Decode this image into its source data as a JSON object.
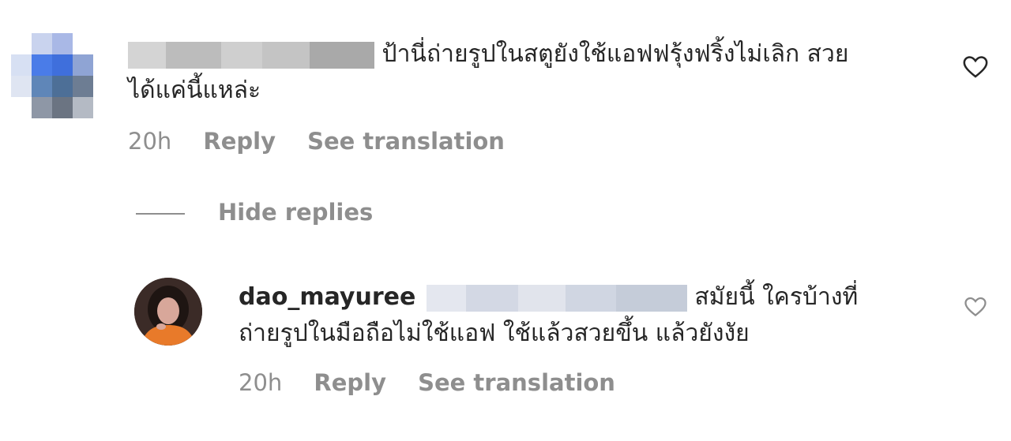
{
  "comments": [
    {
      "text_line1": "ป้านี่ถ่ายรูปในสตูยังใช้แอฟฟรุ้งฟริ้งไม่เลิก สวย",
      "text_line2": "ได้แค่นี้แหล่ะ",
      "time": "20h",
      "reply_label": "Reply",
      "translate_label": "See translation",
      "like_icon": "heart-outline-icon"
    }
  ],
  "hide_replies_label": "Hide replies",
  "replies": [
    {
      "username": "dao_mayuree",
      "text_line1": "สมัยนี้ ใครบ้างที่",
      "text_line2": "ถ่ายรูปในมือถือไม่ใช้แอฟ ใช้แล้วสวยขึ้น แล้วยังงัย",
      "time": "20h",
      "reply_label": "Reply",
      "translate_label": "See translation",
      "like_icon": "heart-outline-icon"
    }
  ],
  "colors": {
    "text_primary": "#262626",
    "text_secondary": "#8e8e8e",
    "background": "#ffffff",
    "avatar_accent": "#e87a2a"
  }
}
